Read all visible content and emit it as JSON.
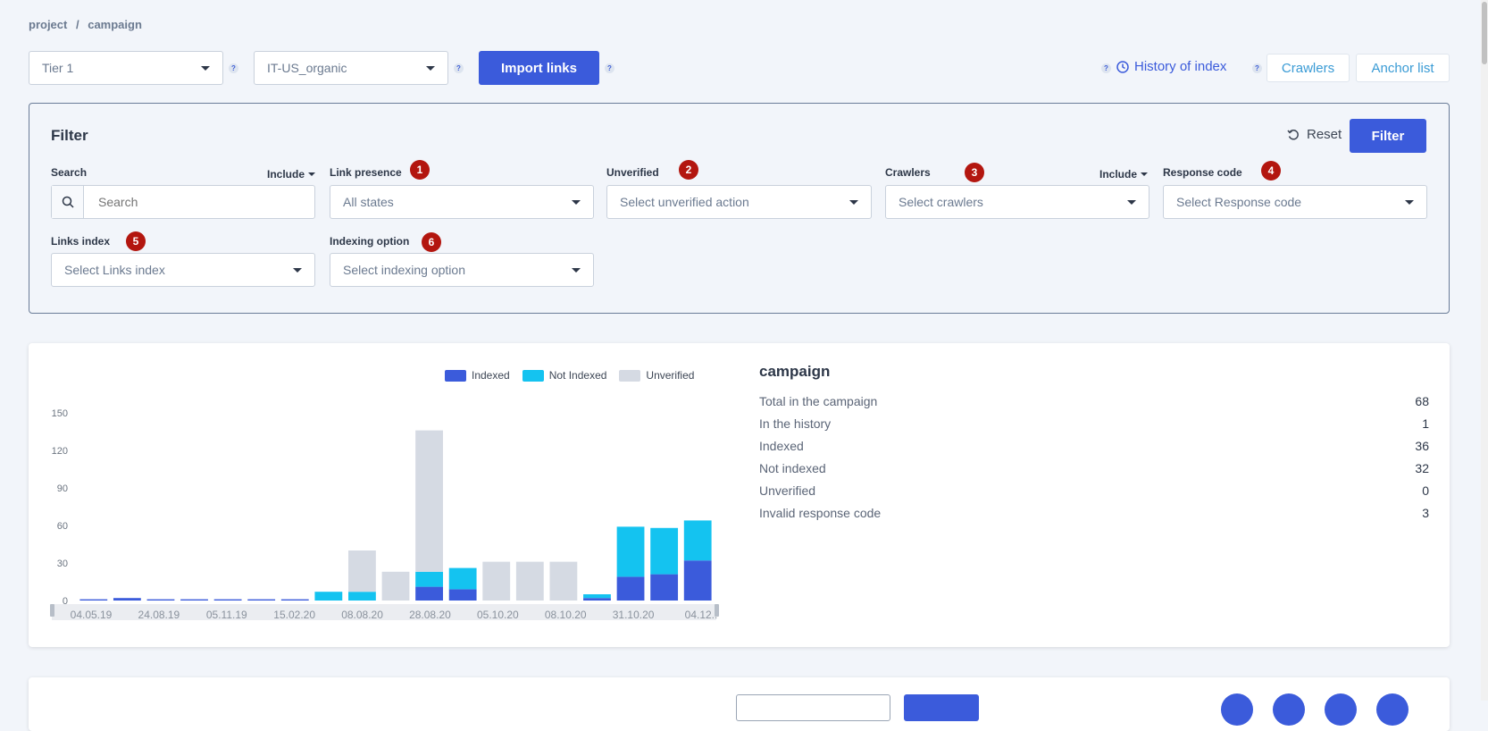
{
  "breadcrumb": {
    "project": "project",
    "sep": "/",
    "current": "campaign"
  },
  "toolbar": {
    "tier_value": "Tier 1",
    "campaign_value": "IT-US_organic",
    "import_label": "Import links",
    "help_mark": "?",
    "history_label": "History of index",
    "crawlers_label": "Crawlers",
    "anchor_label": "Anchor list"
  },
  "filter": {
    "title": "Filter",
    "reset_label": "Reset",
    "filter_label": "Filter",
    "include_label": "Include",
    "search": {
      "label": "Search",
      "placeholder": "Search"
    },
    "link_presence": {
      "label": "Link presence",
      "badge": "1",
      "value": "All states"
    },
    "unverified": {
      "label": "Unverified",
      "badge": "2",
      "value": "Select unverified action"
    },
    "crawlers": {
      "label": "Crawlers",
      "badge": "3",
      "value": "Select crawlers"
    },
    "response_code": {
      "label": "Response code",
      "badge": "4",
      "value": "Select Response code"
    },
    "links_index": {
      "label": "Links index",
      "badge": "5",
      "value": "Select Links index"
    },
    "indexing_option": {
      "label": "Indexing option",
      "badge": "6",
      "value": "Select indexing option"
    }
  },
  "chart_data": {
    "type": "bar",
    "stacked": true,
    "legend": [
      "Indexed",
      "Not Indexed",
      "Unverified"
    ],
    "colors": {
      "indexed": "#3b5bdb",
      "not_indexed": "#14c3f0",
      "unverified": "#d5dae3"
    },
    "ylim": [
      0,
      150
    ],
    "yticks": [
      0,
      30,
      60,
      90,
      120,
      150
    ],
    "xticks": [
      "04.05.19",
      "24.08.19",
      "05.11.19",
      "15.02.20",
      "08.08.20",
      "28.08.20",
      "05.10.20",
      "08.10.20",
      "31.10.20",
      "04.12.."
    ],
    "series": [
      {
        "name": "Indexed",
        "values": [
          1,
          2,
          1,
          1,
          1,
          1,
          1,
          0,
          0,
          0,
          11,
          9,
          0,
          0,
          0,
          2,
          19,
          21,
          32
        ]
      },
      {
        "name": "Not Indexed",
        "values": [
          0,
          0,
          0,
          0,
          0,
          0,
          0,
          7,
          7,
          0,
          12,
          17,
          0,
          0,
          0,
          3,
          40,
          37,
          32
        ]
      },
      {
        "name": "Unverified",
        "values": [
          0,
          0,
          0,
          0,
          0,
          0,
          0,
          0,
          33,
          23,
          113,
          0,
          31,
          31,
          31,
          0,
          0,
          0,
          0
        ]
      }
    ]
  },
  "stats": {
    "title": "campaign",
    "rows": [
      {
        "label": "Total in the campaign",
        "value": "68"
      },
      {
        "label": "In the history",
        "value": "1"
      },
      {
        "label": "Indexed",
        "value": "36"
      },
      {
        "label": "Not indexed",
        "value": "32"
      },
      {
        "label": "Unverified",
        "value": "0"
      },
      {
        "label": "Invalid response code",
        "value": "3"
      }
    ]
  }
}
